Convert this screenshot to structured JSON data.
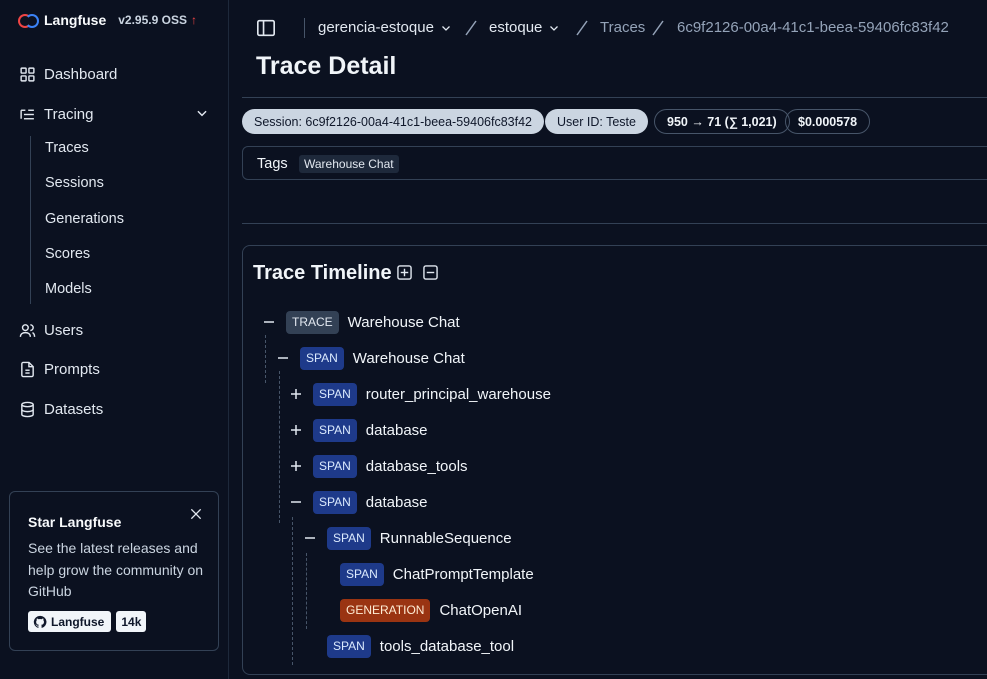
{
  "brand": {
    "name": "Langfuse",
    "version": "v2.95.9 OSS",
    "update_glyph": "↑"
  },
  "sidebar": {
    "items": [
      {
        "label": "Dashboard",
        "icon": "dashboard-icon"
      },
      {
        "label": "Tracing",
        "icon": "tracing-icon"
      },
      {
        "label": "Users",
        "icon": "users-icon"
      },
      {
        "label": "Prompts",
        "icon": "file-icon"
      },
      {
        "label": "Datasets",
        "icon": "database-icon"
      }
    ],
    "tracing_sub": [
      "Traces",
      "Sessions",
      "Generations",
      "Scores",
      "Models"
    ]
  },
  "star_card": {
    "title": "Star Langfuse",
    "description": "See the latest releases and help grow the community on GitHub",
    "button_label": "Langfuse",
    "stars": "14k"
  },
  "breadcrumb": {
    "project_group": "gerencia-estoque",
    "project": "estoque",
    "section": "Traces",
    "trace_id": "6c9f2126-00a4-41c1-beea-59406fc83f42"
  },
  "page": {
    "title": "Trace Detail"
  },
  "pills": {
    "session": "Session: 6c9f2126-00a4-41c1-beea-59406fc83f42",
    "user": "User ID: Teste",
    "tokens": "950 → 71 (∑ 1,021)",
    "cost": "$0.000578"
  },
  "tags": {
    "label": "Tags",
    "items": [
      "Warehouse Chat"
    ]
  },
  "timeline": {
    "title": "Trace Timeline",
    "nodes": [
      {
        "type": "TRACE",
        "name": "Warehouse Chat",
        "toggle": "collapse"
      },
      {
        "type": "SPAN",
        "name": "Warehouse Chat",
        "toggle": "collapse"
      },
      {
        "type": "SPAN",
        "name": "router_principal_warehouse",
        "toggle": "expand"
      },
      {
        "type": "SPAN",
        "name": "database",
        "toggle": "expand"
      },
      {
        "type": "SPAN",
        "name": "database_tools",
        "toggle": "expand"
      },
      {
        "type": "SPAN",
        "name": "database",
        "toggle": "collapse"
      },
      {
        "type": "SPAN",
        "name": "RunnableSequence",
        "toggle": "collapse"
      },
      {
        "type": "SPAN",
        "name": "ChatPromptTemplate",
        "toggle": "none"
      },
      {
        "type": "GENERATION",
        "name": "ChatOpenAI",
        "toggle": "none"
      },
      {
        "type": "SPAN",
        "name": "tools_database_tool",
        "toggle": "none"
      }
    ]
  },
  "colors": {
    "accent": "#ef4444",
    "span": "#1e3a8a",
    "generation": "#9a3412",
    "trace": "#334155"
  }
}
